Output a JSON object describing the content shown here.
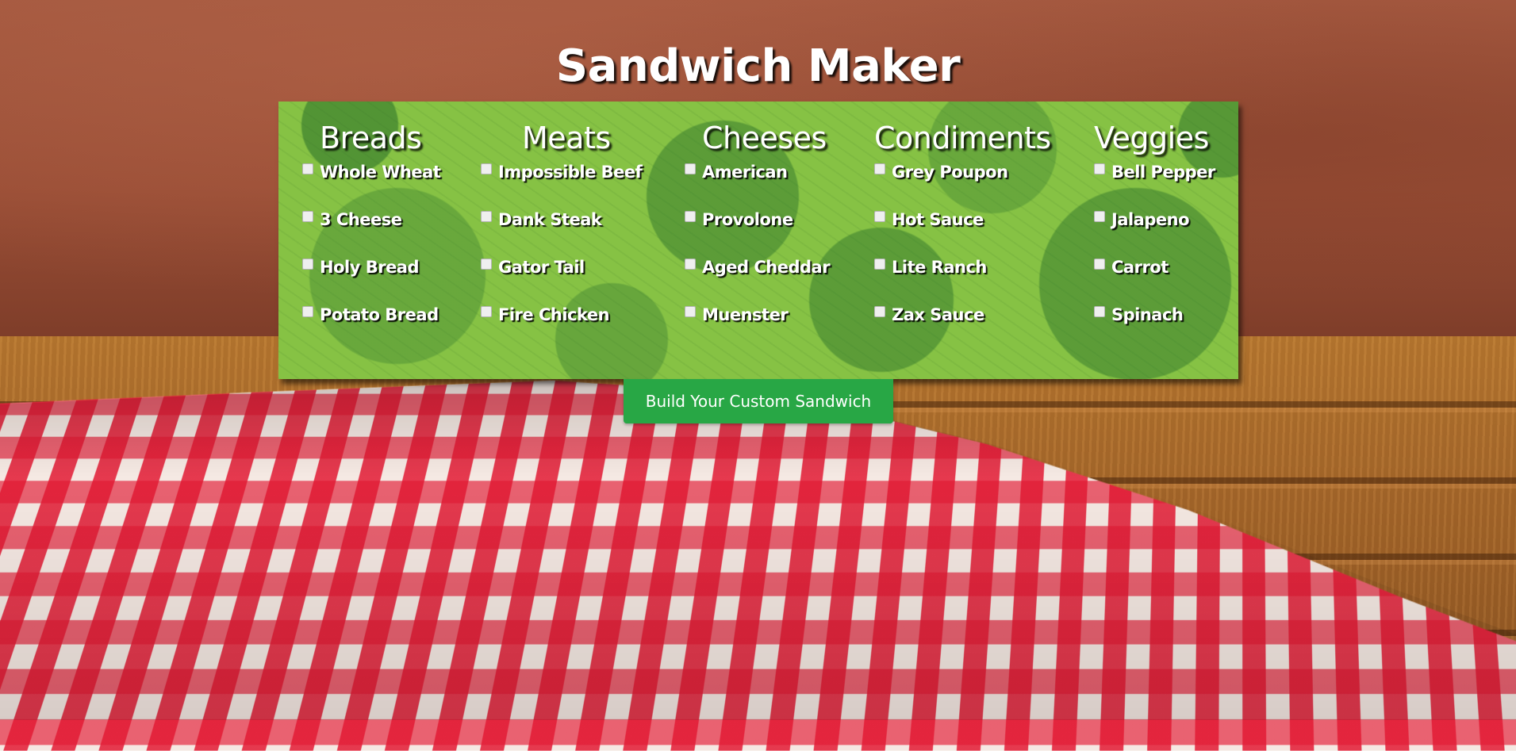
{
  "page": {
    "title": "Sandwich Maker"
  },
  "categories": {
    "breads": {
      "heading": "Breads",
      "items": [
        "Whole Wheat",
        "3 Cheese",
        "Holy Bread",
        "Potato Bread"
      ]
    },
    "meats": {
      "heading": "Meats",
      "items": [
        "Impossible Beef",
        "Dank Steak",
        "Gator Tail",
        "Fire Chicken"
      ]
    },
    "cheeses": {
      "heading": "Cheeses",
      "items": [
        "American",
        "Provolone",
        "Aged Cheddar",
        "Muenster"
      ]
    },
    "condiments": {
      "heading": "Condiments",
      "items": [
        "Grey Poupon",
        "Hot Sauce",
        "Lite Ranch",
        "Zax Sauce"
      ]
    },
    "veggies": {
      "heading": "Veggies",
      "items": [
        "Bell Pepper",
        "Jalapeno",
        "Carrot",
        "Spinach"
      ]
    }
  },
  "actions": {
    "build_label": "Build Your Custom Sandwich"
  },
  "colors": {
    "panel_green": "#86c244",
    "button_green": "#28a745",
    "text": "#ffffff",
    "tablecloth_red": "#e21a34"
  }
}
